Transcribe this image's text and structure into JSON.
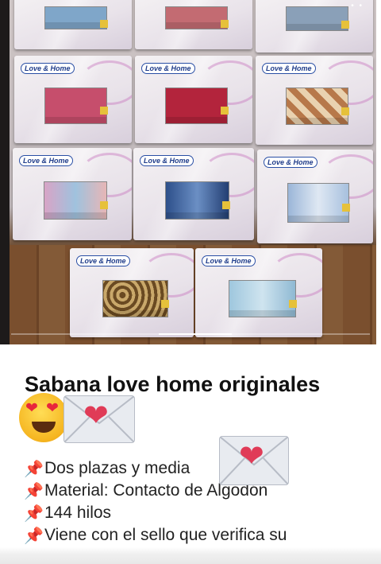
{
  "post": {
    "title": "Sabana love home originales",
    "details": [
      {
        "icon": "pushpin-icon",
        "text": " Dos plazas y media"
      },
      {
        "icon": "pushpin-icon",
        "text": "Material: Contacto de Algodón"
      },
      {
        "icon": "pushpin-icon",
        "text": "144 hilos"
      },
      {
        "icon": "pushpin-icon",
        "text": "Viene con el sello que verifica su"
      }
    ],
    "title_emojis": [
      "smiling-face-with-heart-eyes-icon",
      "love-letter-icon"
    ],
    "line1_emoji": "love-letter-icon"
  },
  "photo": {
    "brand_logo_text": "Love & Home",
    "carousel": {
      "slide_count": 3,
      "active_index": 1
    }
  },
  "colors": {
    "accent_pin": "#d9223b",
    "heart": "#e03b57",
    "text": "#222222"
  }
}
